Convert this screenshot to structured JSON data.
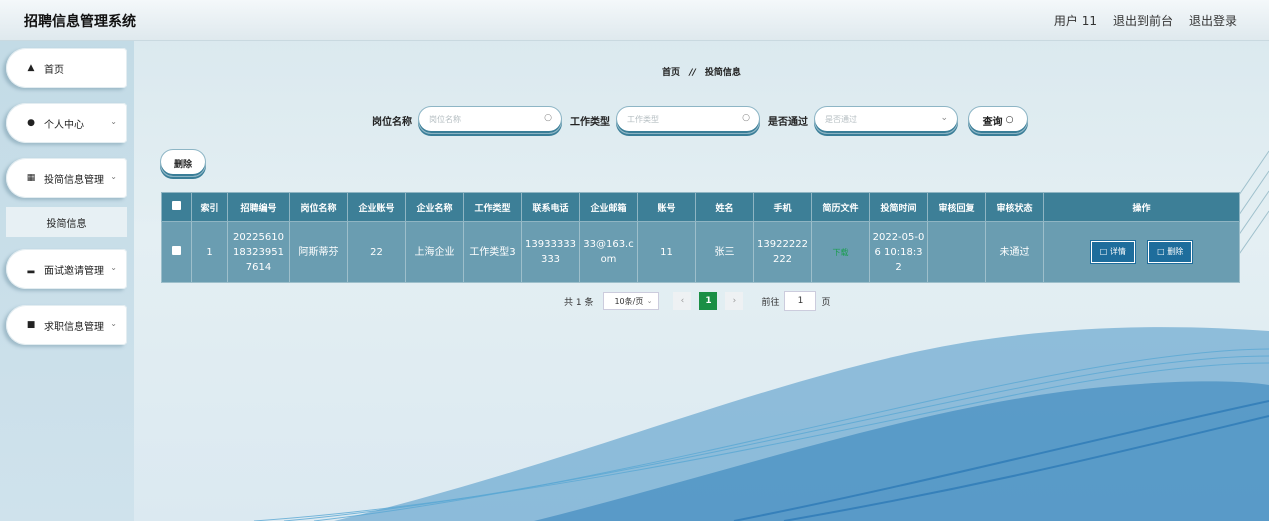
{
  "app_title": "招聘信息管理系统",
  "top_links": [
    "用户 11",
    "退出到前台",
    "退出登录"
  ],
  "sidebar": {
    "items": [
      {
        "label": "首页",
        "icon": "home-icon"
      },
      {
        "label": "个人中心",
        "icon": "user-icon"
      },
      {
        "label": "投简信息管理",
        "icon": "grid-icon"
      },
      {
        "label": "面试邀请管理",
        "icon": "bar-chart-icon"
      },
      {
        "label": "求职信息管理",
        "icon": "message-icon"
      }
    ],
    "sub_item": "投简信息"
  },
  "breadcrumb": {
    "home": "首页",
    "separator": "//",
    "current": "投简信息"
  },
  "search": {
    "job_label": "岗位名称",
    "job_placeholder": "岗位名称",
    "type_label": "工作类型",
    "type_placeholder": "工作类型",
    "passed_label": "是否通过",
    "passed_placeholder": "是否通过",
    "query_label": "查询"
  },
  "delete_label": "删除",
  "table": {
    "headers": [
      "索引",
      "招聘编号",
      "岗位名称",
      "企业账号",
      "企业名称",
      "工作类型",
      "联系电话",
      "企业邮箱",
      "账号",
      "姓名",
      "手机",
      "简历文件",
      "投简时间",
      "审核回复",
      "审核状态",
      "操作"
    ],
    "rows": [
      {
        "index": "1",
        "recruit_no": "20225610183239517614",
        "job_name": "阿斯蒂芬",
        "company_account": "22",
        "company_name": "上海企业",
        "job_type": "工作类型3",
        "phone": "13933333333",
        "email": "33@163.com",
        "account": "11",
        "name": "张三",
        "mobile": "13922222222",
        "resume": "下载",
        "time": "2022-05-06 10:18:32",
        "reply": "",
        "status": "未通过",
        "detail_label": "详情",
        "delete_label": "删除"
      }
    ]
  },
  "pagination": {
    "total": "共 1 条",
    "page_size": "10条/页",
    "current": "1",
    "goto_label": "前往",
    "goto_value": "1",
    "page_unit": "页"
  }
}
